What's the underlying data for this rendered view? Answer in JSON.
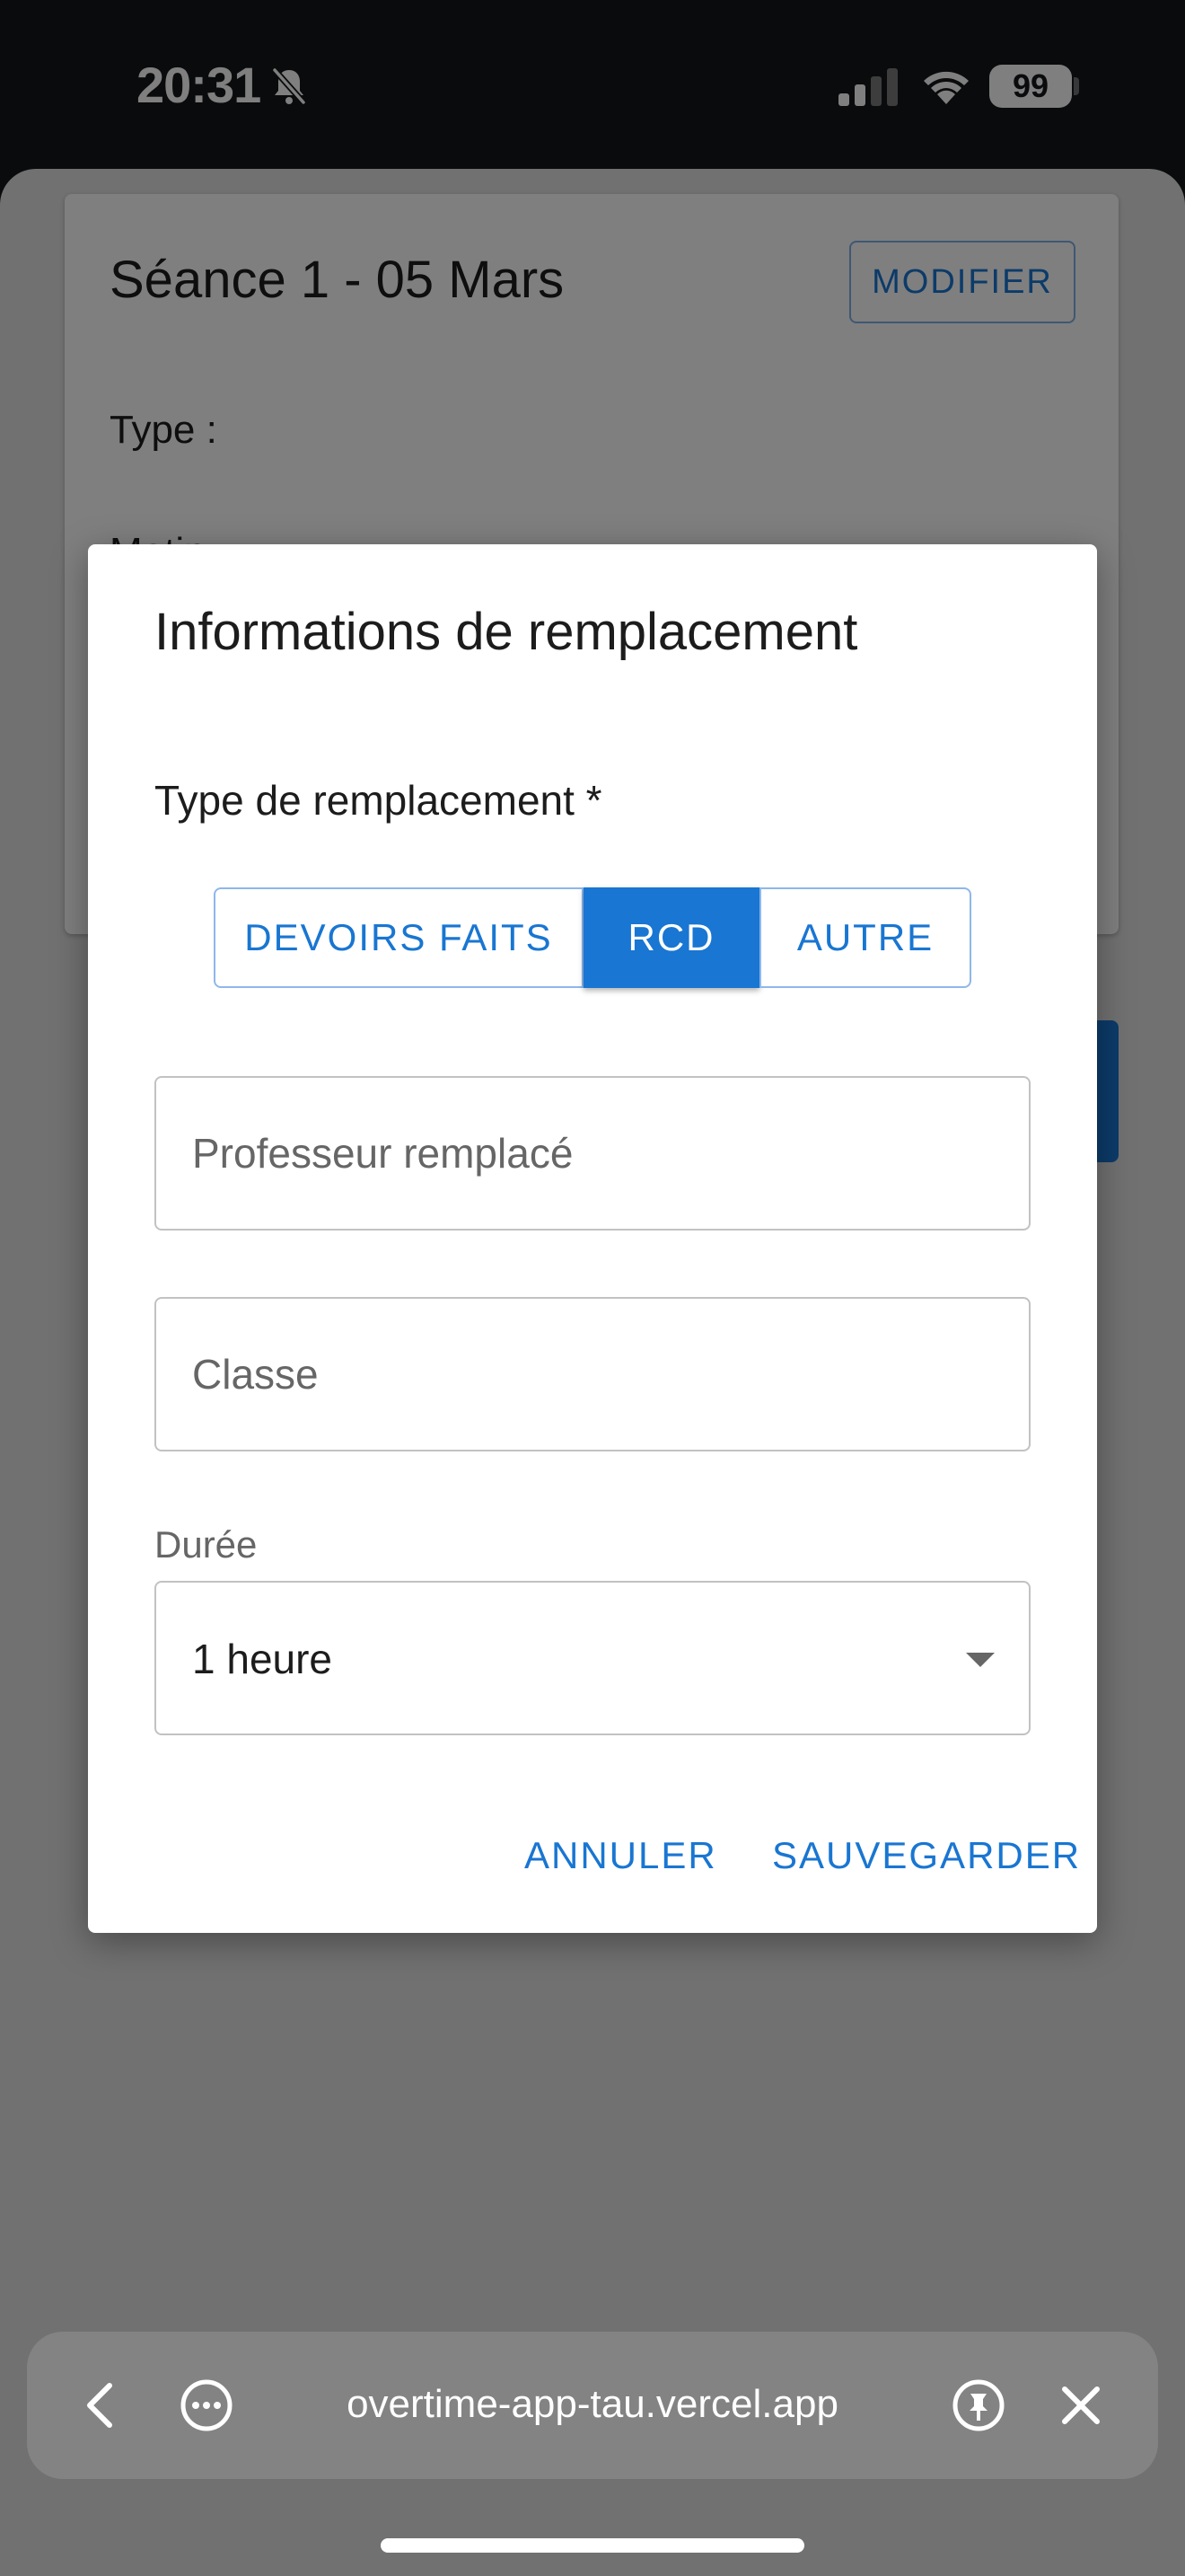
{
  "status_bar": {
    "time": "20:31",
    "battery": "99",
    "icons": [
      "bell-slash-icon",
      "signal-icon",
      "wifi-icon",
      "battery-icon"
    ]
  },
  "background_card": {
    "title": "Séance 1 - 05 Mars",
    "modify_label": "MODIFIER",
    "type_label": "Type :",
    "period": "Matin"
  },
  "dialog": {
    "title": "Informations de remplacement",
    "type_label": "Type de remplacement *",
    "options": [
      "DEVOIRS FAITS",
      "RCD",
      "AUTRE"
    ],
    "selected_option": "RCD",
    "teacher_placeholder": "Professeur remplacé",
    "teacher_value": "",
    "class_placeholder": "Classe",
    "class_value": "",
    "duration_label": "Durée",
    "duration_value": "1 heure",
    "cancel_label": "ANNULER",
    "save_label": "SAUVEGARDER"
  },
  "browser": {
    "url": "overtime-app-tau.vercel.app",
    "icons": [
      "back-icon",
      "more-icon",
      "pin-icon",
      "close-icon"
    ]
  },
  "colors": {
    "accent": "#1976d2",
    "backdrop": "rgba(0,0,0,0.5)"
  }
}
